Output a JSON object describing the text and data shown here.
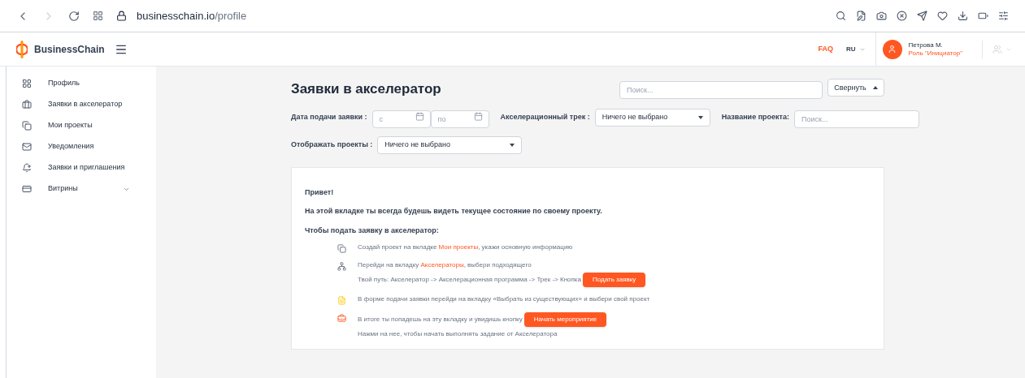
{
  "browser": {
    "url_host": "businesschain.io",
    "url_path": "/profile"
  },
  "header": {
    "brand": "BusinessChain",
    "faq": "FAQ",
    "language": "RU",
    "user": {
      "name": "Петрова М.",
      "role": "Роль \"Инициатор\""
    }
  },
  "sidebar": {
    "items": [
      {
        "label": "Профиль",
        "has_submenu": false
      },
      {
        "label": "Заявки в акселератор",
        "has_submenu": false
      },
      {
        "label": "Мои проекты",
        "has_submenu": false
      },
      {
        "label": "Уведомления",
        "has_submenu": false
      },
      {
        "label": "Заявки и приглашения",
        "has_submenu": false
      },
      {
        "label": "Витрины",
        "has_submenu": true
      }
    ]
  },
  "page": {
    "title": "Заявки в акселератор",
    "search": {
      "placeholder": "Поиск..."
    },
    "collapse_button": "Свернуть",
    "filters": {
      "date_label": "Дата подачи заявки :",
      "date_from": {
        "placeholder": "с"
      },
      "date_to": {
        "placeholder": "по"
      },
      "track_label": "Акселерационный трек :",
      "track_value": "Ничего не выбрано",
      "name_label": "Название проекта:",
      "name_field": {
        "placeholder": "Поиск..."
      },
      "show_label": "Отображать проекты :",
      "show_value": "Ничего не выбрано"
    }
  },
  "info": {
    "greeting": "Привет!",
    "intro": "На этой вкладке ты всегда будешь видеть текущее состояние по своему проекту.",
    "howto": "Чтобы подать заявку в акселератор:",
    "steps": [
      {
        "lines": [
          [
            {
              "kind": "text",
              "text": "Создай проект на вкладке "
            },
            {
              "kind": "link",
              "text": "Мои проекты"
            },
            {
              "kind": "text",
              "text": ", укажи основную информацию"
            }
          ]
        ]
      },
      {
        "lines": [
          [
            {
              "kind": "text",
              "text": "Перейди на вкладку "
            },
            {
              "kind": "link",
              "text": "Акселераторы"
            },
            {
              "kind": "text",
              "text": ", выбери подходящего"
            }
          ],
          [
            {
              "kind": "text",
              "text": "Твой путь: Акселератор -> Акселерационная программа -> Трек -> Кнопка"
            },
            {
              "kind": "button",
              "text": "Подать заявку"
            }
          ]
        ]
      },
      {
        "lines": [
          [
            {
              "kind": "text",
              "text": "В форме подачи заявки перейди на вкладку «Выбрать из существующих» и выбери свой проект"
            }
          ]
        ]
      },
      {
        "lines": [
          [
            {
              "kind": "text",
              "text": "В итоге ты попадешь на эту вкладку и увидишь кнопку"
            },
            {
              "kind": "button",
              "text": "Начать мероприятие"
            }
          ],
          [
            {
              "kind": "text",
              "text": "Нажми на нее, чтобы начать выполнять задание от Акселератора"
            }
          ]
        ]
      }
    ]
  }
}
